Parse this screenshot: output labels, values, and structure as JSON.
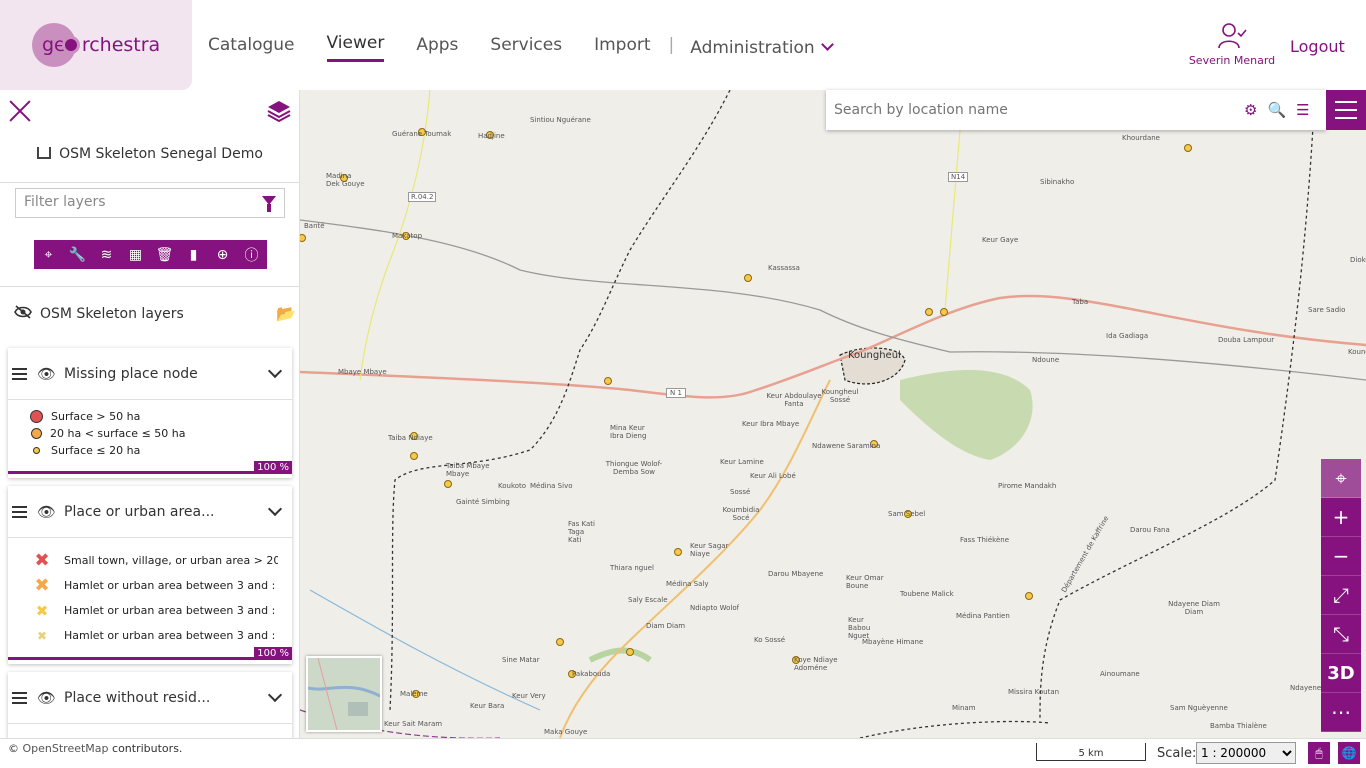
{
  "header": {
    "logo_text": "georchestra",
    "nav": [
      "Catalogue",
      "Viewer",
      "Apps",
      "Services",
      "Import"
    ],
    "active_nav": "Viewer",
    "admin_label": "Administration",
    "user_name": "Severin Menard",
    "logout_label": "Logout",
    "accent_color": "#85127e"
  },
  "sidebar": {
    "map_title": "OSM Skeleton Senegal Demo",
    "filter_placeholder": "Filter layers",
    "toolbar_icons": [
      "zoom-to-icon",
      "wrench-icon",
      "layer-style-icon",
      "table-icon",
      "trash-icon",
      "chart-icon",
      "download-icon",
      "info-icon"
    ],
    "group_name": "OSM Skeleton layers",
    "layers": [
      {
        "name": "Missing place node",
        "legend": [
          "Surface > 50 ha",
          "20 ha < surface ≤ 50 ha",
          "Surface ≤ 20 ha"
        ],
        "opacity": "100 %"
      },
      {
        "name": "Place or urban area...",
        "legend": [
          "Small town, village, or urban area > 20",
          "Hamlet or urban area between 3 and :",
          "Hamlet or urban area between 3 and :",
          "Hamlet or urban area between 3 and :"
        ],
        "opacity": "100 %"
      },
      {
        "name": "Place without resid...",
        "legend": [],
        "opacity": ""
      }
    ]
  },
  "map": {
    "search_placeholder": "Search by location name",
    "labels": [
      {
        "t": "Guérane Toumak"
      },
      {
        "t": "Hadjine"
      },
      {
        "t": "Sintiou Nguérane"
      },
      {
        "t": "Madina Dek Gouye"
      },
      {
        "t": "Banté"
      },
      {
        "t": "Makatop"
      },
      {
        "t": "R.04.2"
      },
      {
        "t": "N14"
      },
      {
        "t": "Khourdane"
      },
      {
        "t": "Sibinakho"
      },
      {
        "t": "Keur Gaye"
      },
      {
        "t": "Kassassa"
      },
      {
        "t": "Taba"
      },
      {
        "t": "Ida Gadiaga"
      },
      {
        "t": "Diokou"
      },
      {
        "t": "Sare Sadio"
      },
      {
        "t": "Douba Lampour"
      },
      {
        "t": "Koungheul"
      },
      {
        "t": "Ndoune"
      },
      {
        "t": "Mbaye Mbaye"
      },
      {
        "t": "N 1"
      },
      {
        "t": "Keur Abdoulaye Fanta"
      },
      {
        "t": "Koungheul Sossé"
      },
      {
        "t": "Keur Ibra Mbaye"
      },
      {
        "t": "Ndawene Saramina"
      },
      {
        "t": "Mina Keur Ibra Dieng"
      },
      {
        "t": "Taiba Ndiaye"
      },
      {
        "t": "Taiba Mbaye Mbaye"
      },
      {
        "t": "Koukoto"
      },
      {
        "t": "Médina Sivo"
      },
      {
        "t": "Thiongue Wolof-Demba Sow"
      },
      {
        "t": "Keur Lamine"
      },
      {
        "t": "Keur Ali Lobé"
      },
      {
        "t": "Pirome Mandakh"
      },
      {
        "t": "Gainté Simbing"
      },
      {
        "t": "Sossé"
      },
      {
        "t": "Koumbidia Socé"
      },
      {
        "t": "Sam Sebel"
      },
      {
        "t": "Fas Kati Taga Kati"
      },
      {
        "t": "Fass Thiékène"
      },
      {
        "t": "Darou Fana"
      },
      {
        "t": "Keur Sagar Niaye"
      },
      {
        "t": "Thiara nguel"
      },
      {
        "t": "Darou Mbayene"
      },
      {
        "t": "Keur Omar Boune"
      },
      {
        "t": "Toubene Malick"
      },
      {
        "t": "Médina Saly"
      },
      {
        "t": "Saly Escale"
      },
      {
        "t": "Ndiapto Wolof"
      },
      {
        "t": "Diam Diam"
      },
      {
        "t": "Keur Babou Nguet"
      },
      {
        "t": "Ndayene Diam Diam"
      },
      {
        "t": "Médina Pantien"
      },
      {
        "t": "Ko Sossé"
      },
      {
        "t": "Mbayène Himane"
      },
      {
        "t": "Sine Matar"
      },
      {
        "t": "Pakabouda"
      },
      {
        "t": "Koye Ndiaye Adoméne"
      },
      {
        "t": "Ainoumane"
      },
      {
        "t": "Malème"
      },
      {
        "t": "Keur Bara"
      },
      {
        "t": "Keur Very"
      },
      {
        "t": "Missira Koutan"
      },
      {
        "t": "Minam"
      },
      {
        "t": "Sam Nguèyenne"
      },
      {
        "t": "Ndayene"
      },
      {
        "t": "Bamba Thialène"
      },
      {
        "t": "Keur Sait Maram"
      },
      {
        "t": "Maka Gouye"
      },
      {
        "t": "Département de Kaffrine"
      },
      {
        "t": "Koung"
      }
    ],
    "controls": [
      "locate-icon",
      "zoom-in-icon",
      "zoom-out-icon",
      "zoom-to-extent-icon",
      "fullscreen-icon",
      "3D",
      "more-icon"
    ]
  },
  "footer": {
    "attribution_link": "OpenStreetMap",
    "attribution_rest": " contributors.",
    "scalebar_label": "5 km",
    "scale_label": "Scale:",
    "scale_value": "1 : 200000"
  }
}
